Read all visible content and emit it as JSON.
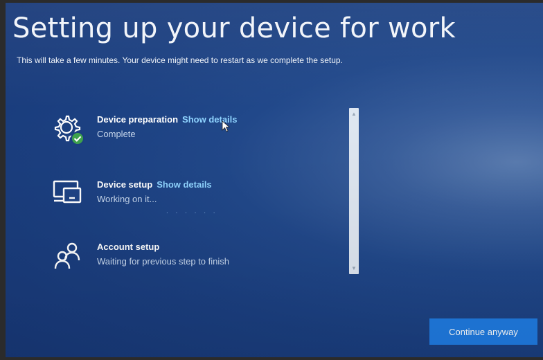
{
  "title": "Setting up your device for work",
  "subtitle": "This will take a few minutes. Your device might need to restart as we complete the setup.",
  "steps": [
    {
      "name": "Device preparation",
      "link": "Show details",
      "status": "Complete",
      "icon": "gear-check-icon"
    },
    {
      "name": "Device setup",
      "link": "Show details",
      "status": "Working on it...",
      "icon": "devices-icon"
    },
    {
      "name": "Account setup",
      "link": "",
      "status": "Waiting for previous step to finish",
      "icon": "people-icon"
    }
  ],
  "progress_dots": ". . . . . .",
  "continue_label": "Continue anyway",
  "colors": {
    "background": "#1b3f80",
    "link": "#8fd4ff",
    "button": "#1f7ae0",
    "check": "#3fa34d"
  }
}
